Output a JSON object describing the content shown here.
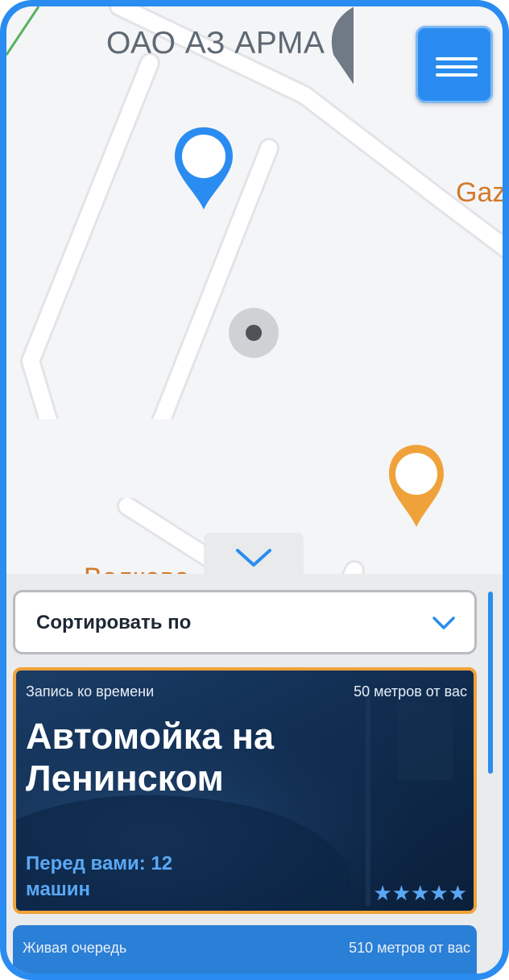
{
  "map": {
    "labels": {
      "oao": "ОАО АЗ АРМА",
      "gaz": "Gaz",
      "volk": "Волкова"
    }
  },
  "colors": {
    "accent": "#2a8cf0",
    "pin_orange": "#f0a23a",
    "card_highlight": "#f0a23a"
  },
  "icons": {
    "menu": "menu-icon",
    "sheet_toggle": "chevron-down-icon",
    "sort": "chevron-down-icon"
  },
  "sort": {
    "label": "Сортировать по"
  },
  "cards": [
    {
      "type": "Запись ко времени",
      "distance": "50 метров от вас",
      "title": "Автомойка на Ленинском",
      "queue": "Перед вами: 12 машин",
      "rating": 5,
      "stars": "★★★★★"
    },
    {
      "type": "Живая очередь",
      "distance": "510 метров от вас"
    }
  ]
}
